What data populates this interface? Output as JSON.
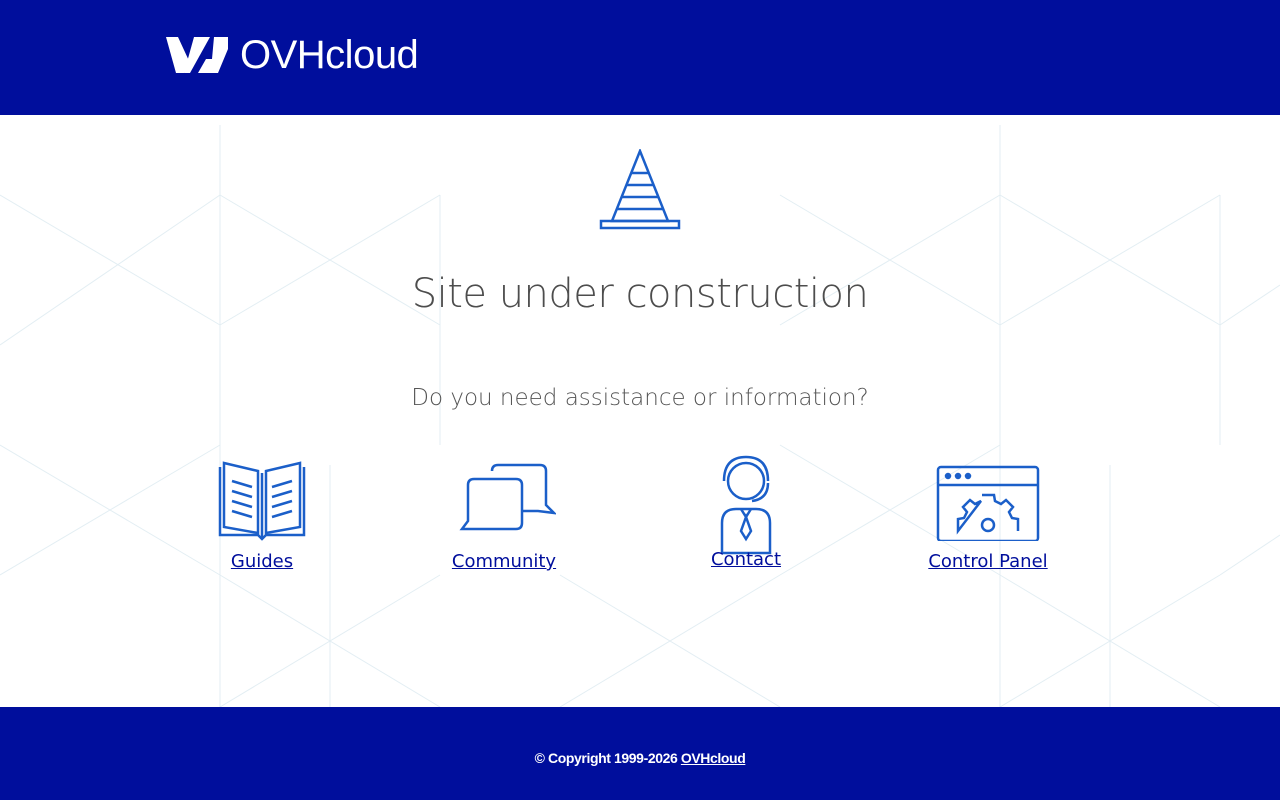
{
  "header": {
    "logo_text": "OVHcloud"
  },
  "main": {
    "title": "Site under construction",
    "subtitle": "Do you need assistance or information?",
    "links": [
      {
        "label": "Guides",
        "icon": "book-icon"
      },
      {
        "label": "Community",
        "icon": "chat-bubbles-icon"
      },
      {
        "label": "Contact",
        "icon": "support-agent-icon"
      },
      {
        "label": "Control Panel",
        "icon": "control-panel-gear-icon"
      }
    ]
  },
  "footer": {
    "copyright": "© Copyright 1999-2026 ",
    "link_text": "OVHcloud"
  },
  "colors": {
    "brand_blue": "#000e9c",
    "icon_blue": "#1b5fc9",
    "text_gray": "#4d4d4d"
  }
}
